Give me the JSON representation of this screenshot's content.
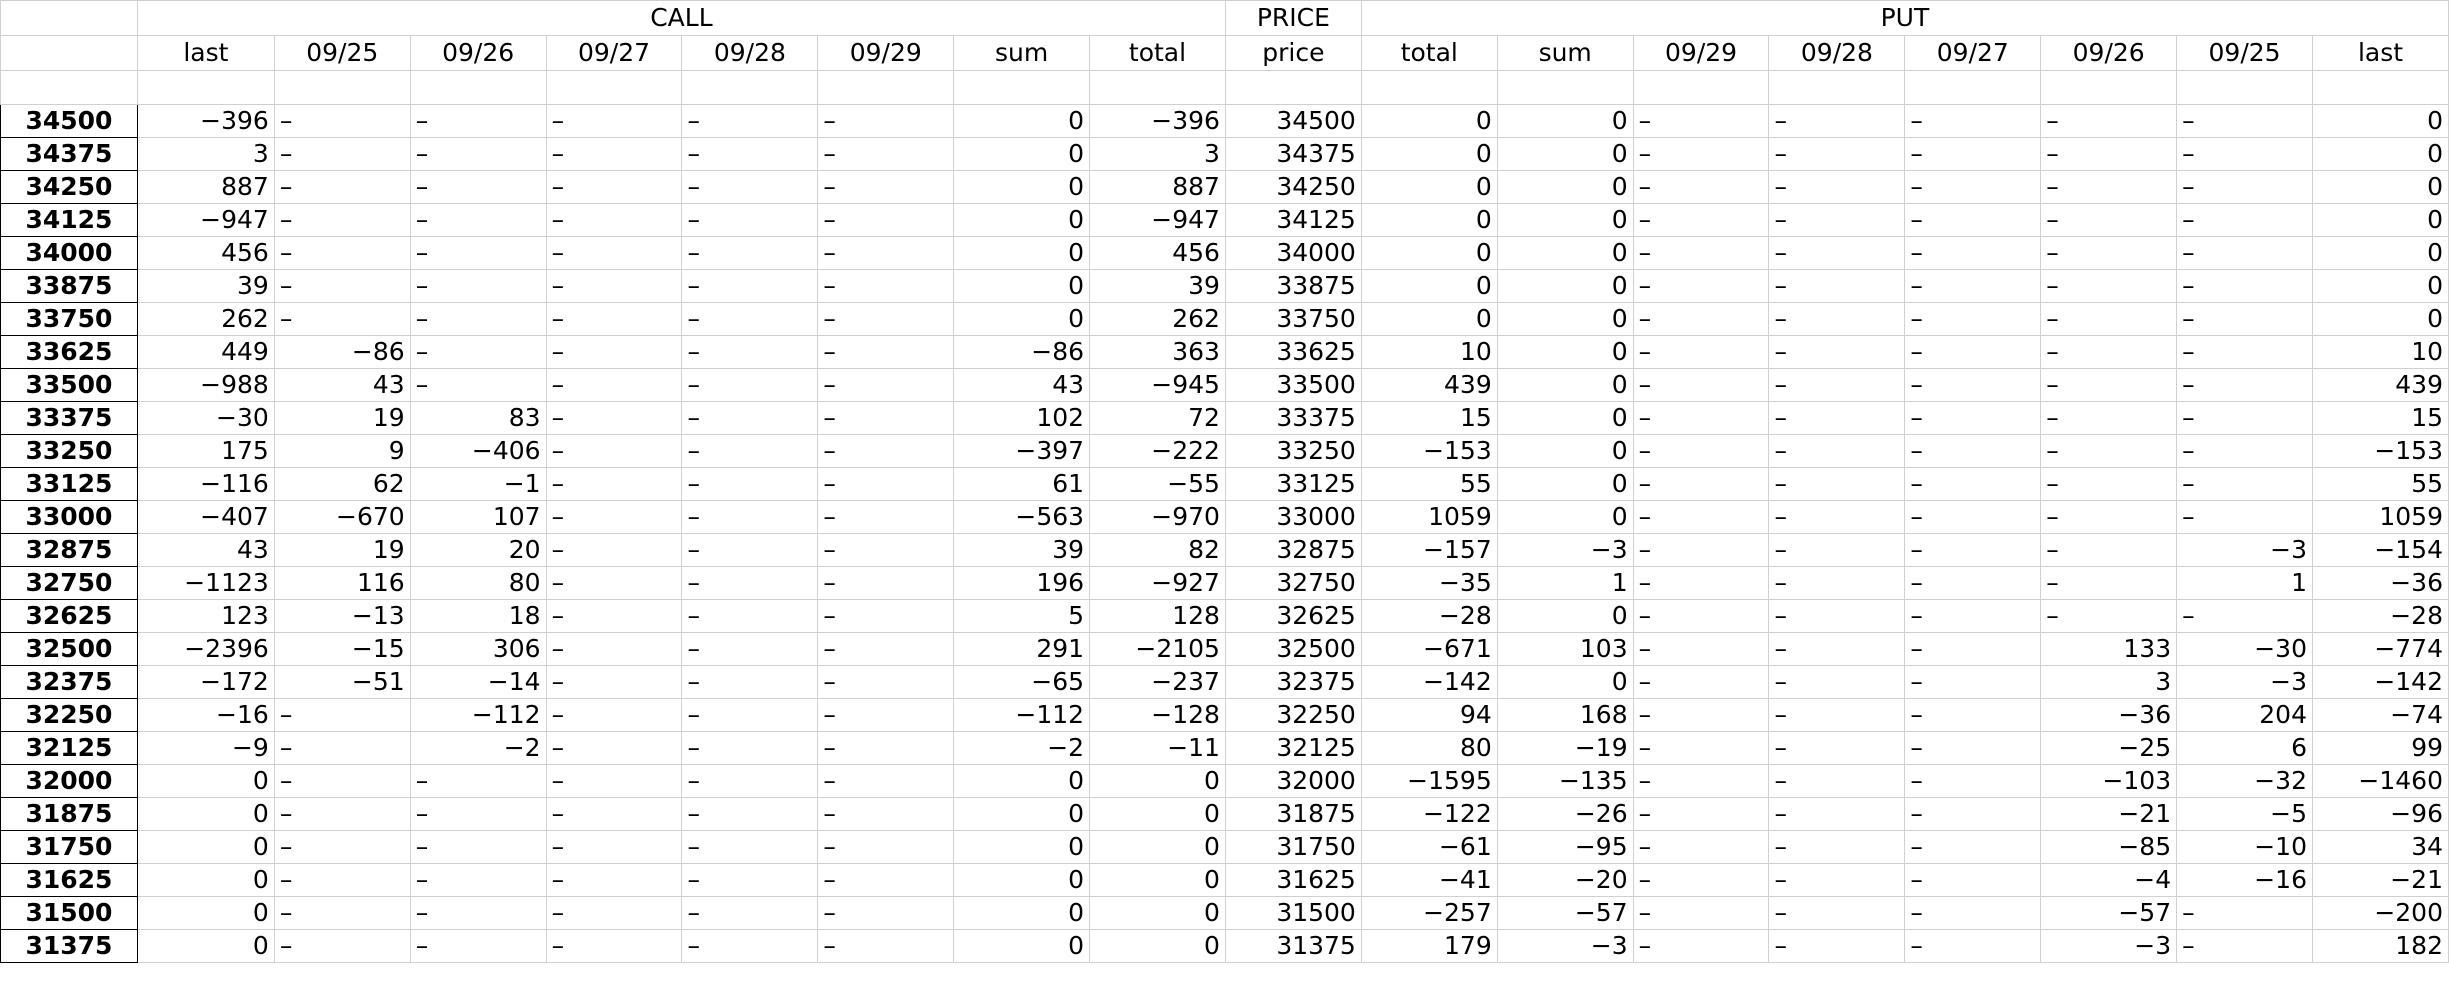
{
  "header": {
    "call_label": "CALL",
    "price_label": "PRICE",
    "put_label": "PUT"
  },
  "columns": [
    "last",
    "09/25",
    "09/26",
    "09/27",
    "09/28",
    "09/29",
    "sum",
    "total",
    "price",
    "total",
    "sum",
    "09/29",
    "09/28",
    "09/27",
    "09/26",
    "09/25",
    "last"
  ],
  "rows": [
    {
      "label": "34500",
      "cells": [
        "-396",
        "-",
        "-",
        "-",
        "-",
        "-",
        "0",
        "-396",
        "34500",
        "0",
        "0",
        "-",
        "-",
        "-",
        "-",
        "-",
        "0"
      ]
    },
    {
      "label": "34375",
      "cells": [
        "3",
        "-",
        "-",
        "-",
        "-",
        "-",
        "0",
        "3",
        "34375",
        "0",
        "0",
        "-",
        "-",
        "-",
        "-",
        "-",
        "0"
      ]
    },
    {
      "label": "34250",
      "cells": [
        "887",
        "-",
        "-",
        "-",
        "-",
        "-",
        "0",
        "887",
        "34250",
        "0",
        "0",
        "-",
        "-",
        "-",
        "-",
        "-",
        "0"
      ]
    },
    {
      "label": "34125",
      "cells": [
        "-947",
        "-",
        "-",
        "-",
        "-",
        "-",
        "0",
        "-947",
        "34125",
        "0",
        "0",
        "-",
        "-",
        "-",
        "-",
        "-",
        "0"
      ]
    },
    {
      "label": "34000",
      "cells": [
        "456",
        "-",
        "-",
        "-",
        "-",
        "-",
        "0",
        "456",
        "34000",
        "0",
        "0",
        "-",
        "-",
        "-",
        "-",
        "-",
        "0"
      ]
    },
    {
      "label": "33875",
      "cells": [
        "39",
        "-",
        "-",
        "-",
        "-",
        "-",
        "0",
        "39",
        "33875",
        "0",
        "0",
        "-",
        "-",
        "-",
        "-",
        "-",
        "0"
      ]
    },
    {
      "label": "33750",
      "cells": [
        "262",
        "-",
        "-",
        "-",
        "-",
        "-",
        "0",
        "262",
        "33750",
        "0",
        "0",
        "-",
        "-",
        "-",
        "-",
        "-",
        "0"
      ]
    },
    {
      "label": "33625",
      "cells": [
        "449",
        "-86",
        "-",
        "-",
        "-",
        "-",
        "-86",
        "363",
        "33625",
        "10",
        "0",
        "-",
        "-",
        "-",
        "-",
        "-",
        "10"
      ]
    },
    {
      "label": "33500",
      "cells": [
        "-988",
        "43",
        "-",
        "-",
        "-",
        "-",
        "43",
        "-945",
        "33500",
        "439",
        "0",
        "-",
        "-",
        "-",
        "-",
        "-",
        "439"
      ]
    },
    {
      "label": "33375",
      "cells": [
        "-30",
        "19",
        "83",
        "-",
        "-",
        "-",
        "102",
        "72",
        "33375",
        "15",
        "0",
        "-",
        "-",
        "-",
        "-",
        "-",
        "15"
      ]
    },
    {
      "label": "33250",
      "cells": [
        "175",
        "9",
        "-406",
        "-",
        "-",
        "-",
        "-397",
        "-222",
        "33250",
        "-153",
        "0",
        "-",
        "-",
        "-",
        "-",
        "-",
        "-153"
      ]
    },
    {
      "label": "33125",
      "cells": [
        "-116",
        "62",
        "-1",
        "-",
        "-",
        "-",
        "61",
        "-55",
        "33125",
        "55",
        "0",
        "-",
        "-",
        "-",
        "-",
        "-",
        "55"
      ]
    },
    {
      "label": "33000",
      "cells": [
        "-407",
        "-670",
        "107",
        "-",
        "-",
        "-",
        "-563",
        "-970",
        "33000",
        "1059",
        "0",
        "-",
        "-",
        "-",
        "-",
        "-",
        "1059"
      ]
    },
    {
      "label": "32875",
      "cells": [
        "43",
        "19",
        "20",
        "-",
        "-",
        "-",
        "39",
        "82",
        "32875",
        "-157",
        "-3",
        "-",
        "-",
        "-",
        "-",
        "-3",
        "-154"
      ]
    },
    {
      "label": "32750",
      "cells": [
        "-1123",
        "116",
        "80",
        "-",
        "-",
        "-",
        "196",
        "-927",
        "32750",
        "-35",
        "1",
        "-",
        "-",
        "-",
        "-",
        "1",
        "-36"
      ]
    },
    {
      "label": "32625",
      "cells": [
        "123",
        "-13",
        "18",
        "-",
        "-",
        "-",
        "5",
        "128",
        "32625",
        "-28",
        "0",
        "-",
        "-",
        "-",
        "-",
        "-",
        "-28"
      ]
    },
    {
      "label": "32500",
      "cells": [
        "-2396",
        "-15",
        "306",
        "-",
        "-",
        "-",
        "291",
        "-2105",
        "32500",
        "-671",
        "103",
        "-",
        "-",
        "-",
        "133",
        "-30",
        "-774"
      ]
    },
    {
      "label": "32375",
      "cells": [
        "-172",
        "-51",
        "-14",
        "-",
        "-",
        "-",
        "-65",
        "-237",
        "32375",
        "-142",
        "0",
        "-",
        "-",
        "-",
        "3",
        "-3",
        "-142"
      ]
    },
    {
      "label": "32250",
      "cells": [
        "-16",
        "-",
        "-112",
        "-",
        "-",
        "-",
        "-112",
        "-128",
        "32250",
        "94",
        "168",
        "-",
        "-",
        "-",
        "-36",
        "204",
        "-74"
      ]
    },
    {
      "label": "32125",
      "cells": [
        "-9",
        "-",
        "-2",
        "-",
        "-",
        "-",
        "-2",
        "-11",
        "32125",
        "80",
        "-19",
        "-",
        "-",
        "-",
        "-25",
        "6",
        "99"
      ]
    },
    {
      "label": "32000",
      "cells": [
        "0",
        "-",
        "-",
        "-",
        "-",
        "-",
        "0",
        "0",
        "32000",
        "-1595",
        "-135",
        "-",
        "-",
        "-",
        "-103",
        "-32",
        "-1460"
      ]
    },
    {
      "label": "31875",
      "cells": [
        "0",
        "-",
        "-",
        "-",
        "-",
        "-",
        "0",
        "0",
        "31875",
        "-122",
        "-26",
        "-",
        "-",
        "-",
        "-21",
        "-5",
        "-96"
      ]
    },
    {
      "label": "31750",
      "cells": [
        "0",
        "-",
        "-",
        "-",
        "-",
        "-",
        "0",
        "0",
        "31750",
        "-61",
        "-95",
        "-",
        "-",
        "-",
        "-85",
        "-10",
        "34"
      ]
    },
    {
      "label": "31625",
      "cells": [
        "0",
        "-",
        "-",
        "-",
        "-",
        "-",
        "0",
        "0",
        "31625",
        "-41",
        "-20",
        "-",
        "-",
        "-",
        "-4",
        "-16",
        "-21"
      ]
    },
    {
      "label": "31500",
      "cells": [
        "0",
        "-",
        "-",
        "-",
        "-",
        "-",
        "0",
        "0",
        "31500",
        "-257",
        "-57",
        "-",
        "-",
        "-",
        "-57",
        "-",
        "-200"
      ]
    },
    {
      "label": "31375",
      "cells": [
        "0",
        "-",
        "-",
        "-",
        "-",
        "-",
        "0",
        "0",
        "31375",
        "179",
        "-3",
        "-",
        "-",
        "-",
        "-3",
        "-",
        "182"
      ]
    }
  ]
}
